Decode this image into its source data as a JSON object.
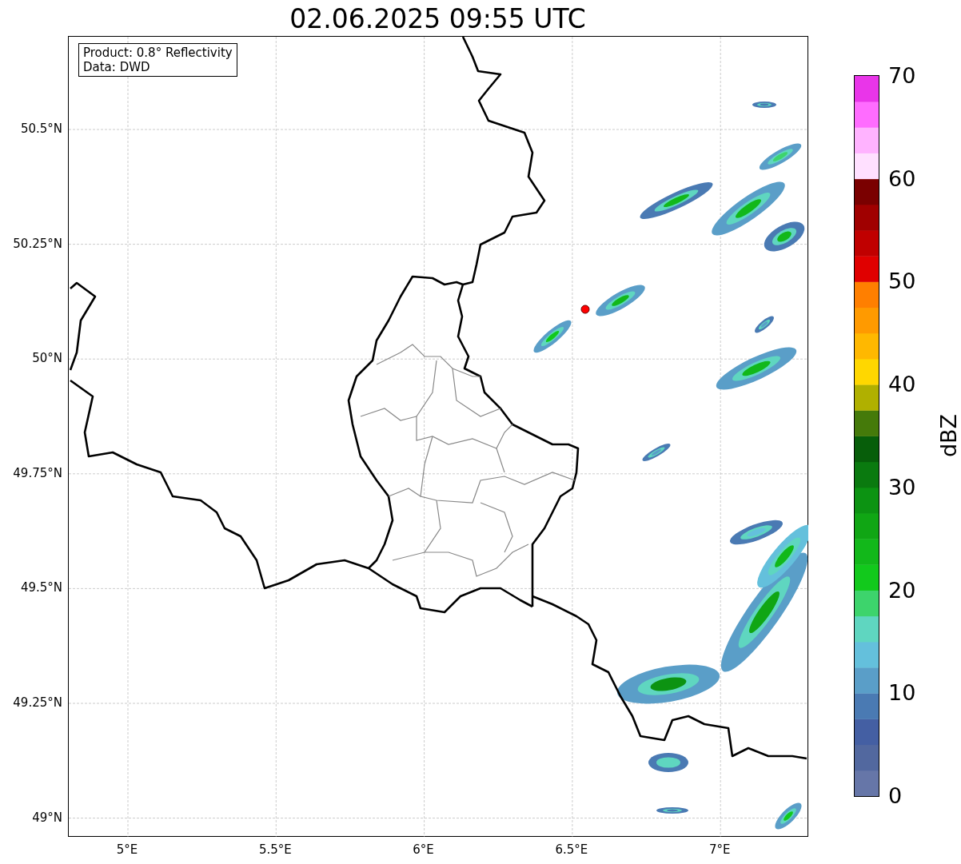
{
  "title": "02.06.2025 09:55 UTC",
  "info_box": {
    "lines": [
      "Product: 0.8° Reflectivity",
      "Data: DWD"
    ]
  },
  "x_ticks": [
    "5°E",
    "5.5°E",
    "6°E",
    "6.5°E",
    "7°E"
  ],
  "y_ticks": [
    "50.5°N",
    "50.25°N",
    "50°N",
    "49.75°N",
    "49.5°N",
    "49.25°N",
    "49°N"
  ],
  "colorbar": {
    "label": "dBZ",
    "ticks": [
      "70",
      "60",
      "50",
      "40",
      "30",
      "20",
      "10",
      "0"
    ],
    "bins": [
      {
        "color": "#6676a8"
      },
      {
        "color": "#52689f"
      },
      {
        "color": "#445fa3"
      },
      {
        "color": "#4a7ab3"
      },
      {
        "color": "#5a9ec8"
      },
      {
        "color": "#64c0dc"
      },
      {
        "color": "#5fd6c0"
      },
      {
        "color": "#3dd46c"
      },
      {
        "color": "#12c91c"
      },
      {
        "color": "#12b81a"
      },
      {
        "color": "#10a614"
      },
      {
        "color": "#0c9312"
      },
      {
        "color": "#0a7a0f"
      },
      {
        "color": "#075e0a"
      },
      {
        "color": "#457a0a"
      },
      {
        "color": "#b0b000"
      },
      {
        "color": "#ffd700"
      },
      {
        "color": "#ffb800"
      },
      {
        "color": "#ff9a00"
      },
      {
        "color": "#ff7f00"
      },
      {
        "color": "#e00000"
      },
      {
        "color": "#c00000"
      },
      {
        "color": "#a00000"
      },
      {
        "color": "#7a0000"
      },
      {
        "color": "#ffe0ff"
      },
      {
        "color": "#ffb3ff"
      },
      {
        "color": "#ff6cff"
      },
      {
        "color": "#e935e9"
      }
    ]
  }
}
